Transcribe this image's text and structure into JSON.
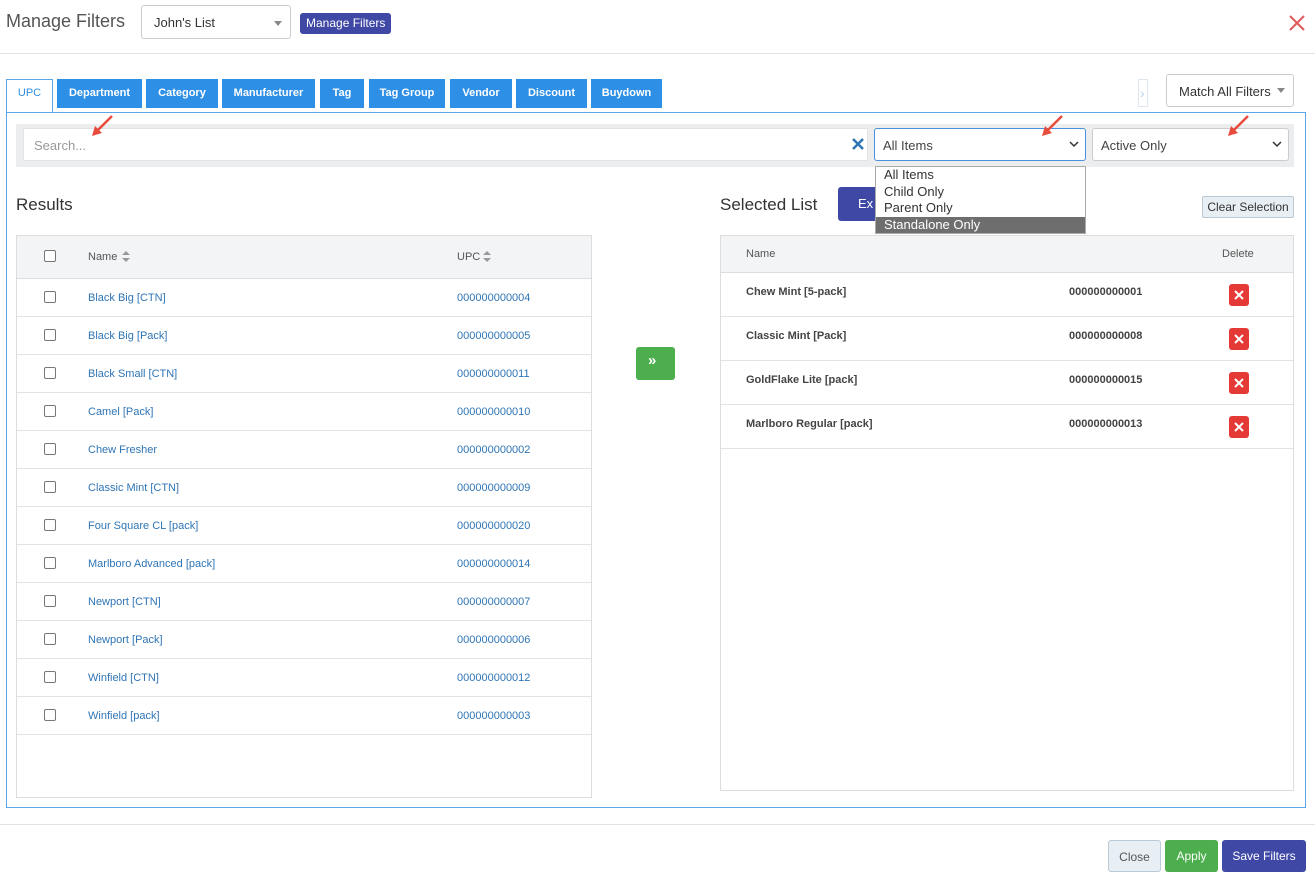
{
  "header": {
    "title": "Manage Filters",
    "list_select_value": "John's List",
    "manage_button": "Manage Filters"
  },
  "tabs": [
    "UPC",
    "Department",
    "Category",
    "Manufacturer",
    "Tag",
    "Tag Group",
    "Vendor",
    "Discount",
    "Buydown"
  ],
  "match_select": "Match All Filters",
  "search": {
    "placeholder": "Search...",
    "items_select": "All Items",
    "status_select": "Active Only",
    "items_options": [
      "All Items",
      "Child Only",
      "Parent Only",
      "Standalone Only"
    ],
    "items_highlighted": "Standalone Only"
  },
  "results": {
    "title": "Results",
    "col_name": "Name",
    "col_upc": "UPC",
    "rows": [
      {
        "name": "Black Big [CTN]",
        "upc": "000000000004"
      },
      {
        "name": "Black Big [Pack]",
        "upc": "000000000005"
      },
      {
        "name": "Black Small [CTN]",
        "upc": "000000000011"
      },
      {
        "name": "Camel [Pack]",
        "upc": "000000000010"
      },
      {
        "name": "Chew Fresher",
        "upc": "000000000002"
      },
      {
        "name": "Classic Mint [CTN]",
        "upc": "000000000009"
      },
      {
        "name": "Four Square CL [pack]",
        "upc": "000000000020"
      },
      {
        "name": "Marlboro Advanced [pack]",
        "upc": "000000000014"
      },
      {
        "name": "Newport [CTN]",
        "upc": "000000000007"
      },
      {
        "name": "Newport [Pack]",
        "upc": "000000000006"
      },
      {
        "name": "Winfield [CTN]",
        "upc": "000000000012"
      },
      {
        "name": "Winfield [pack]",
        "upc": "000000000003"
      }
    ]
  },
  "selected": {
    "title": "Selected List",
    "export_button": "Ex",
    "clear_button": "Clear Selection",
    "col_name": "Name",
    "col_delete": "Delete",
    "rows": [
      {
        "name": "Chew Mint [5-pack]",
        "upc": "000000000001"
      },
      {
        "name": "Classic Mint [Pack]",
        "upc": "000000000008"
      },
      {
        "name": "GoldFlake Lite [pack]",
        "upc": "000000000015"
      },
      {
        "name": "Marlboro Regular [pack]",
        "upc": "000000000013"
      }
    ]
  },
  "footer": {
    "close": "Close",
    "apply": "Apply",
    "save": "Save Filters"
  },
  "colors": {
    "primary": "#3f48a5",
    "tab_blue": "#2e8fe6",
    "success": "#4cae4c",
    "danger": "#e53935",
    "link": "#2f75b5"
  }
}
